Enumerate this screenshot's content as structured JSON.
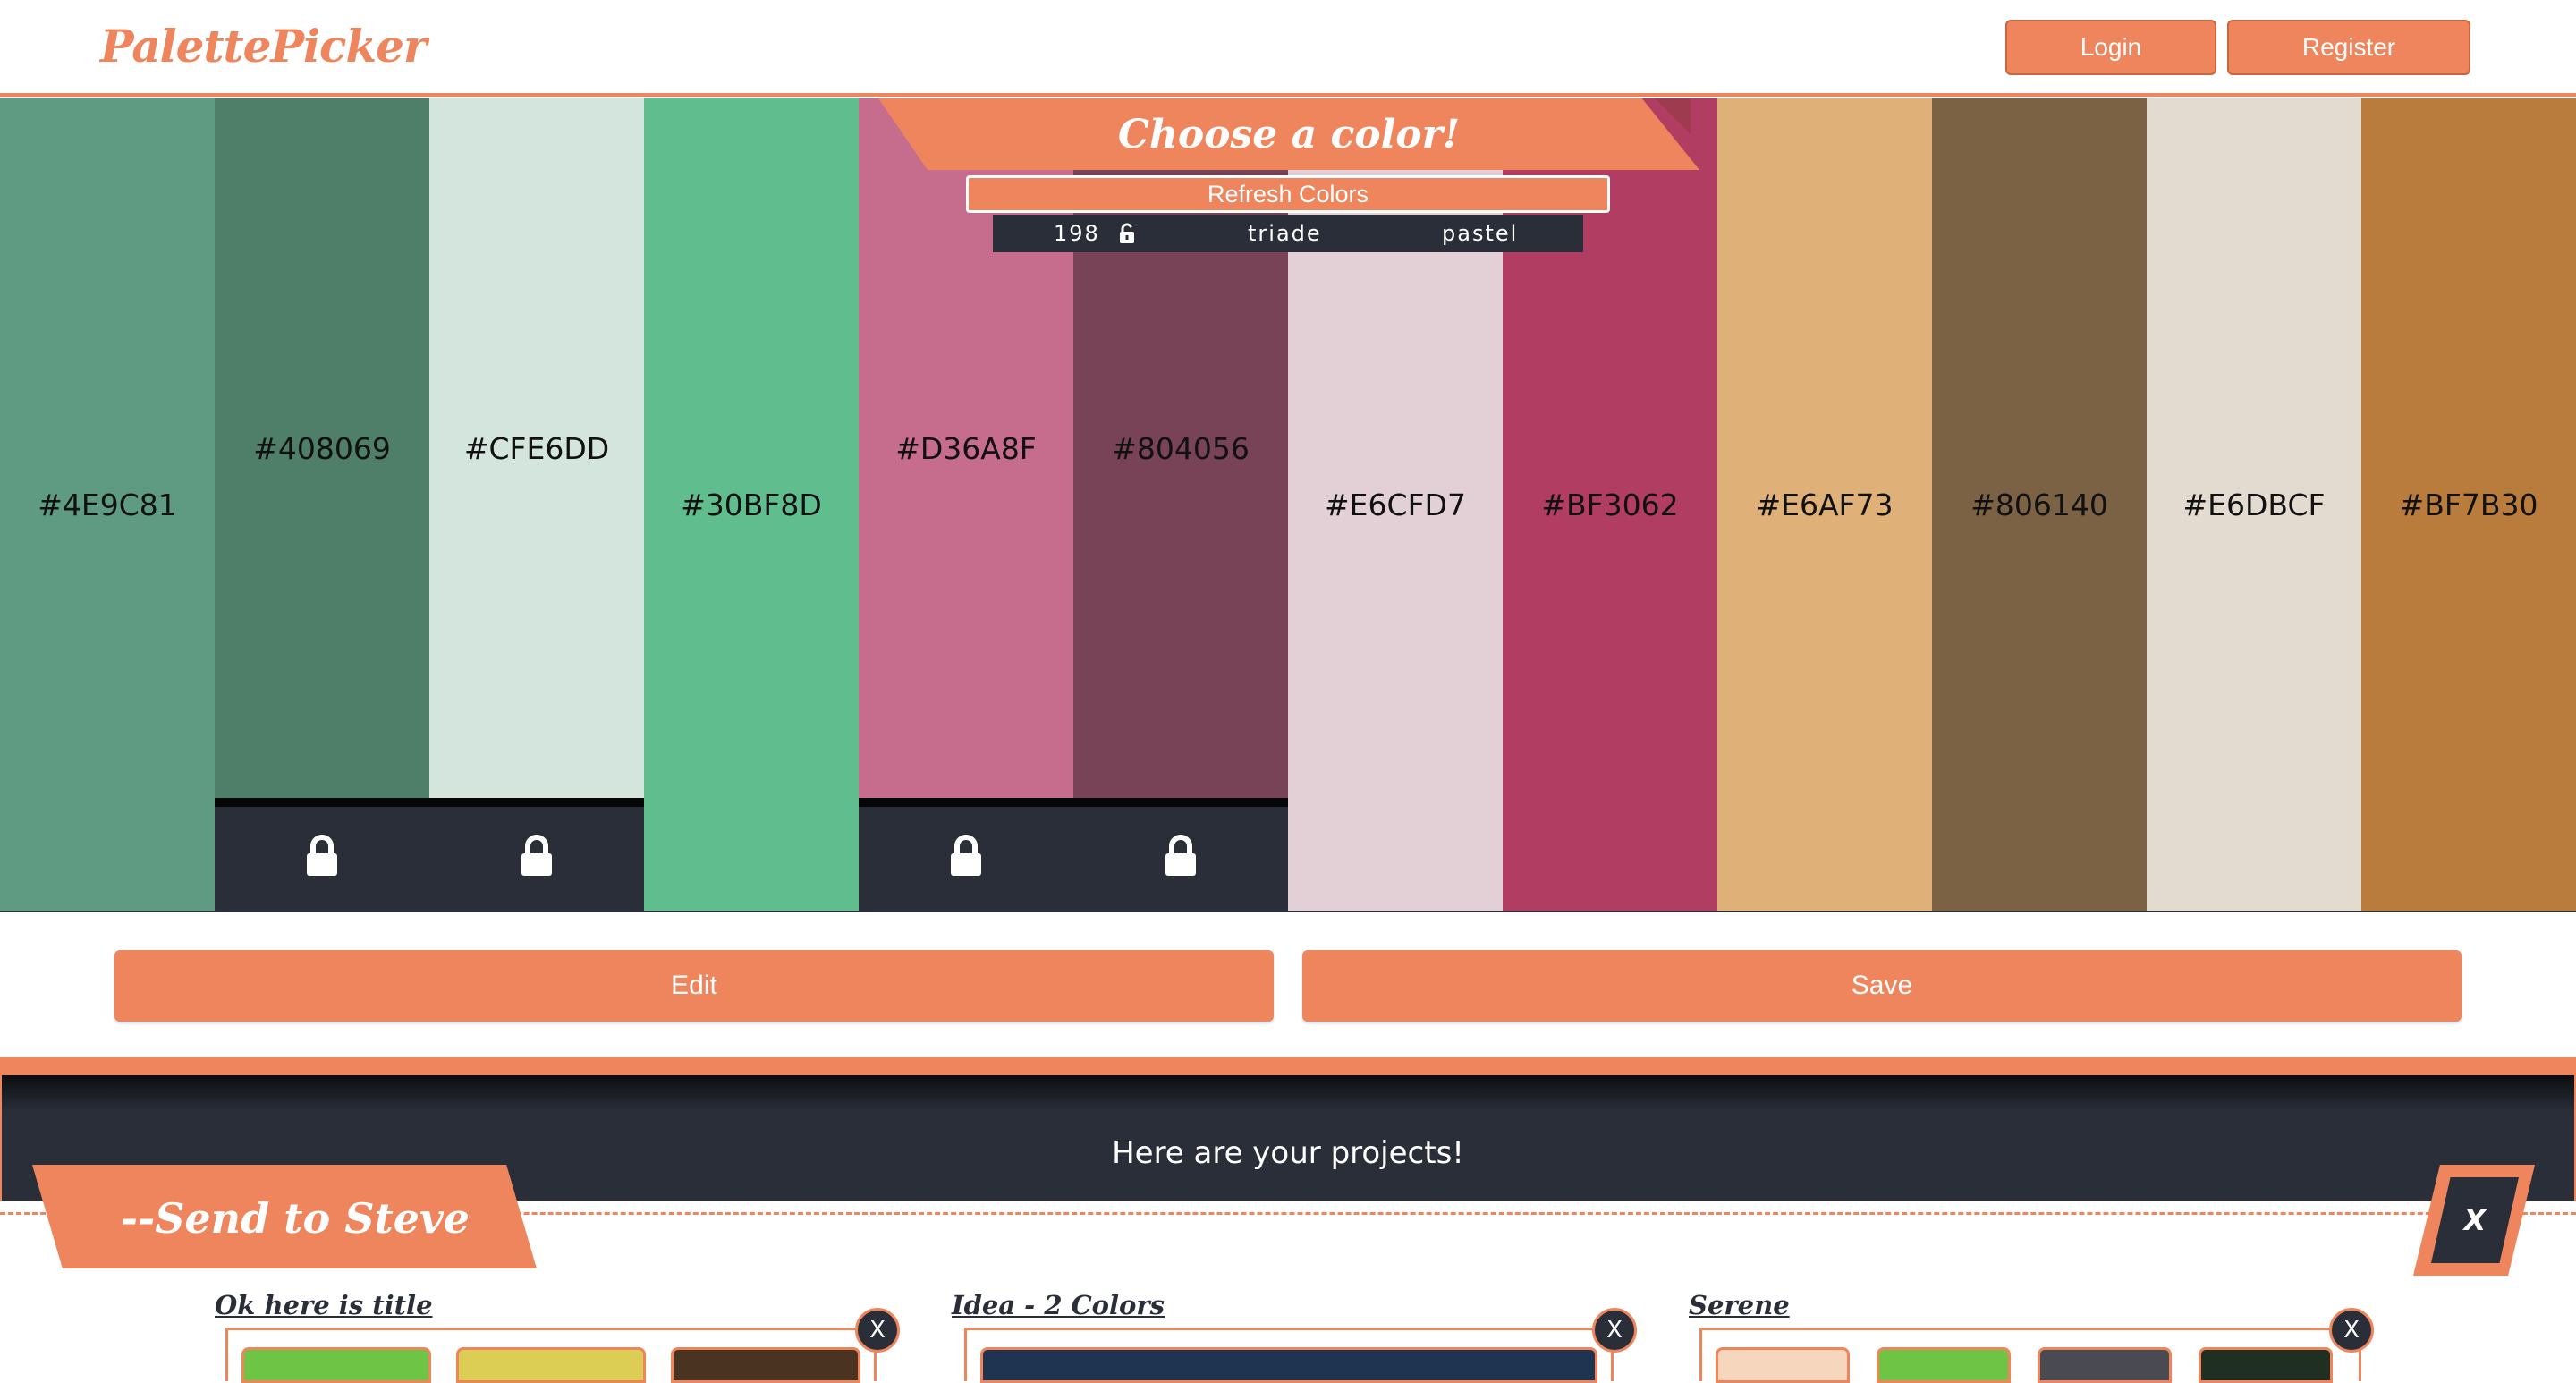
{
  "header": {
    "logo": "PalettePicker",
    "login_label": "Login",
    "register_label": "Register"
  },
  "generator": {
    "banner": "Choose a color!",
    "refresh_label": "Refresh Colors",
    "count": "198",
    "mode": "triade",
    "tone": "pastel",
    "lock_icon": "unlock-icon"
  },
  "palette": [
    {
      "hex": "#4E9C81",
      "color": "#5e9b82",
      "locked": false
    },
    {
      "hex": "#408069",
      "color": "#4f7e69",
      "locked": true
    },
    {
      "hex": "#CFE6DD",
      "color": "#d3e5dd",
      "locked": true
    },
    {
      "hex": "#30BF8D",
      "color": "#5fbd8e",
      "locked": false
    },
    {
      "hex": "#D36A8F",
      "color": "#c66c8c",
      "locked": true
    },
    {
      "hex": "#804056",
      "color": "#784356",
      "locked": true
    },
    {
      "hex": "#E6CFD7",
      "color": "#e2d0d6",
      "locked": false
    },
    {
      "hex": "#BF3062",
      "color": "#b23d62",
      "locked": false
    },
    {
      "hex": "#E6AF73",
      "color": "#e0b079",
      "locked": false
    },
    {
      "hex": "#806140",
      "color": "#7b6244",
      "locked": false
    },
    {
      "hex": "#E6DBCF",
      "color": "#e3dad0",
      "locked": false
    },
    {
      "hex": "#BF7B30",
      "color": "#b97c3c",
      "locked": false
    }
  ],
  "actions": {
    "edit_label": "Edit",
    "save_label": "Save"
  },
  "projects": {
    "heading": "Here are your projects!",
    "folder_label": "--Send to Steve",
    "close_label": "X",
    "cards": [
      {
        "title": "Ok here is title",
        "x_label": "X",
        "chips": [
          "#6dc445",
          "#dccd55",
          "#4a3320"
        ]
      },
      {
        "title": "Idea - 2 Colors",
        "x_label": "X",
        "chips": [
          "#1e3450"
        ]
      },
      {
        "title": "Serene",
        "x_label": "X",
        "chips": [
          "#f6d6bd",
          "#6dc445",
          "#4a4b52",
          "#1f2f22"
        ]
      }
    ]
  },
  "colors": {
    "accent": "#ef855c",
    "dark": "#2a2e38"
  }
}
